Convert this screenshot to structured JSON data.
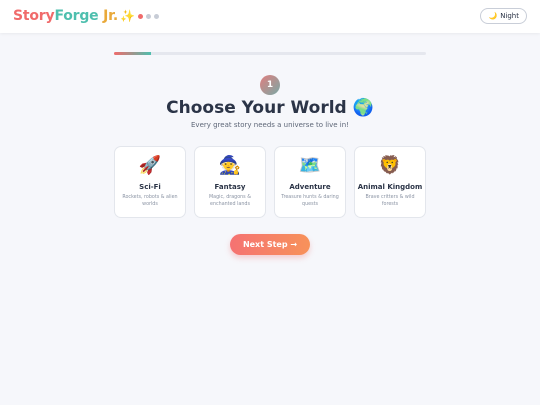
{
  "brand": {
    "part1": "Story",
    "part2": "Forge",
    "part3": " Jr.",
    "sparkle": "✨"
  },
  "status_dots": [
    {
      "color": "#f06b6b"
    },
    {
      "color": "#c7ccd6"
    },
    {
      "color": "#c7ccd6"
    }
  ],
  "theme_toggle": {
    "icon": "🌙",
    "label": "Night"
  },
  "progress": {
    "fraction": 0.12
  },
  "step": {
    "number": "1",
    "title": "Choose Your World 🌍",
    "subtitle": "Every great story needs a universe to live in!"
  },
  "worlds": [
    {
      "icon": "🚀",
      "icon_name": "rocket-icon",
      "title": "Sci-Fi",
      "desc": "Rockets, robots & alien worlds"
    },
    {
      "icon": "🧙",
      "icon_name": "wizard-icon",
      "title": "Fantasy",
      "desc": "Magic, dragons & enchanted lands"
    },
    {
      "icon": "🗺️",
      "icon_name": "map-icon",
      "title": "Adventure",
      "desc": "Treasure hunts & daring quests"
    },
    {
      "icon": "🦁",
      "icon_name": "lion-icon",
      "title": "Animal Kingdom",
      "desc": "Brave critters & wild forests"
    }
  ],
  "next_button": {
    "label": "Next Step →"
  },
  "colors": {
    "accent_coral": "#f06b6b",
    "accent_teal": "#4ebfae",
    "accent_gold": "#e9a93a",
    "background": "#f6f7fb"
  }
}
